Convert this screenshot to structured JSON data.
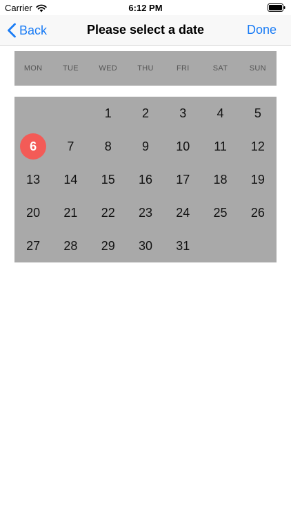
{
  "status_bar": {
    "carrier": "Carrier",
    "time": "6:12 PM",
    "icons": [
      "wifi-icon",
      "battery-icon"
    ]
  },
  "nav": {
    "back_label": "Back",
    "title": "Please select a date",
    "done_label": "Done"
  },
  "calendar": {
    "weekdays": [
      "MON",
      "TUE",
      "WED",
      "THU",
      "FRI",
      "SAT",
      "SUN"
    ],
    "days": [
      "",
      "",
      "1",
      "2",
      "3",
      "4",
      "5",
      "6",
      "7",
      "8",
      "9",
      "10",
      "11",
      "12",
      "13",
      "14",
      "15",
      "16",
      "17",
      "18",
      "19",
      "20",
      "21",
      "22",
      "23",
      "24",
      "25",
      "26",
      "27",
      "28",
      "29",
      "30",
      "31",
      "",
      ""
    ],
    "selected_day": "6"
  },
  "colors": {
    "accent": "#1a7cf5",
    "calendar_bg": "#a9a9a9",
    "selected_day_bg": "#f35b57"
  }
}
